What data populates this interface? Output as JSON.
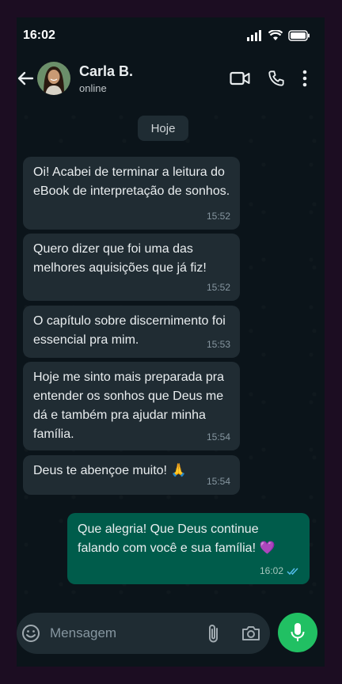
{
  "status_bar": {
    "time": "16:02"
  },
  "header": {
    "contact_name": "Carla B.",
    "contact_status": "online"
  },
  "chat": {
    "date_chip": "Hoje",
    "messages": [
      {
        "direction": "in",
        "text": "Oi! Acabei de terminar a leitura do eBook de interpretação de sonhos.",
        "time": "15:52"
      },
      {
        "direction": "in",
        "text": "Quero dizer que foi uma das melhores aquisições que já fiz!",
        "time": "15:52"
      },
      {
        "direction": "in",
        "text": "O capítulo sobre discernimento foi essencial pra mim.",
        "time": "15:53"
      },
      {
        "direction": "in",
        "text": "Hoje me sinto mais preparada pra entender os sonhos que Deus me dá e também pra ajudar minha família.",
        "time": "15:54"
      },
      {
        "direction": "in",
        "text": "Deus te abençoe muito! 🙏",
        "time": "15:54"
      },
      {
        "direction": "out",
        "text": "Que alegria! Que Deus continue falando com você e sua família! 💜",
        "time": "16:02",
        "read": true
      }
    ]
  },
  "composer": {
    "placeholder": "Mensagem"
  },
  "colors": {
    "incoming_bubble": "#202c33",
    "outgoing_bubble": "#005c4b",
    "accent": "#21c063",
    "background": "#0b141a"
  },
  "icons": [
    "signal-icon",
    "wifi-icon",
    "battery-icon",
    "back-arrow-icon",
    "video-call-icon",
    "phone-icon",
    "more-icon",
    "emoji-icon",
    "attach-icon",
    "camera-icon",
    "mic-icon",
    "double-check-icon"
  ]
}
